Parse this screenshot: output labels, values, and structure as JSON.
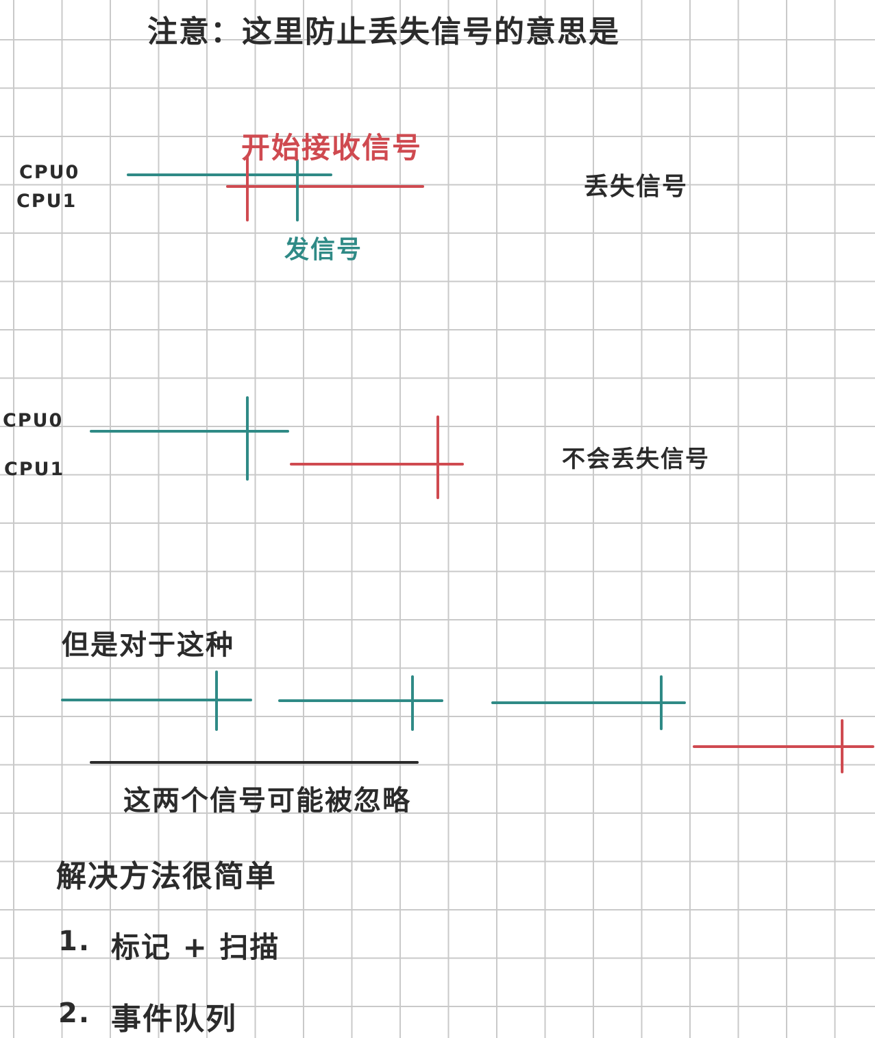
{
  "title": "注意：这里防止丢失信号的意思是",
  "scenario1": {
    "cpu0": "CPU0",
    "cpu1": "CPU1",
    "receive": "开始接收信号",
    "send": "发信号",
    "lost": "丢失信号"
  },
  "scenario2": {
    "cpu0": "CPU0",
    "cpu1": "CPU1",
    "not_lost": "不会丢失信号"
  },
  "scenario3": {
    "intro": "但是对于这种",
    "ignored": "这两个信号可能被忽略"
  },
  "solution": {
    "heading": "解决方法很简单",
    "item1_num": "1.",
    "item1": "标记 + 扫描",
    "item2_num": "2.",
    "item2": "事件队列"
  },
  "colors": {
    "teal": "#2f8a86",
    "red": "#cf4a50",
    "ink": "#2b2b2b",
    "grid": "#c9c9c9"
  }
}
